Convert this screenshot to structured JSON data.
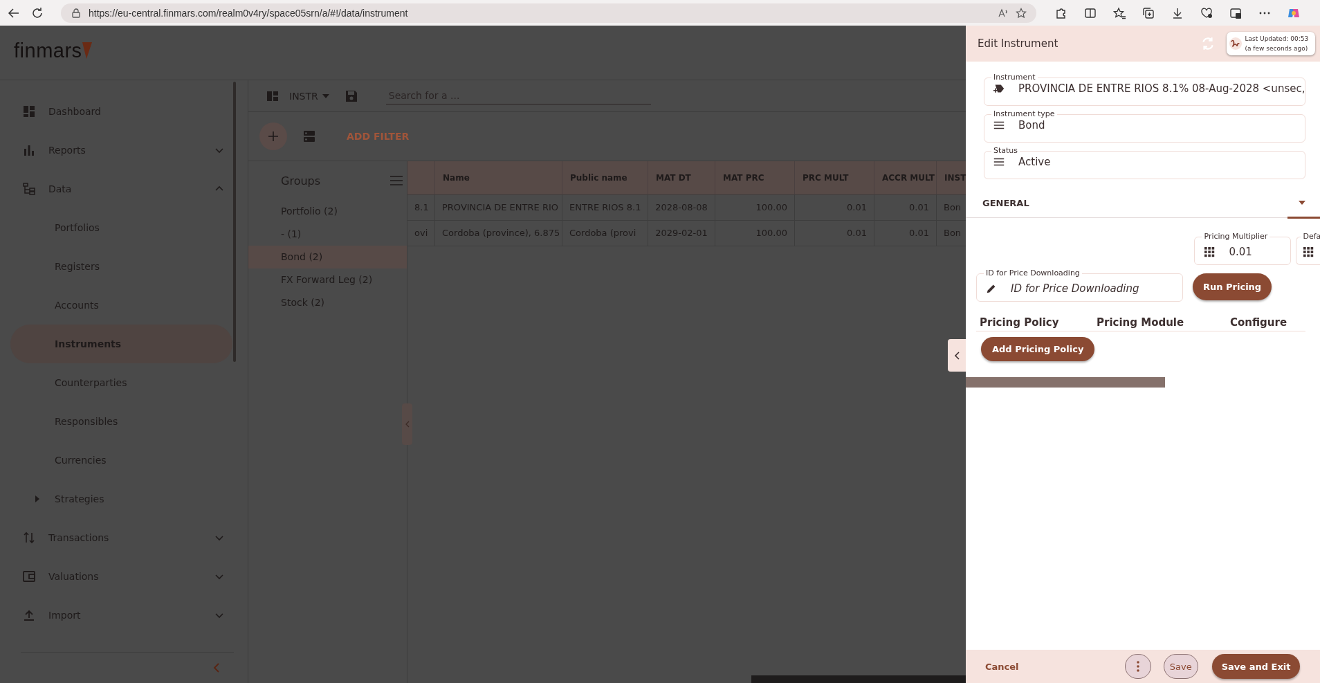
{
  "browser": {
    "url": "https://eu-central.finmars.com/realm0v4ry/space05srn/a/#!/data/instrument"
  },
  "app": {
    "logo": "finmars"
  },
  "sidebar": {
    "items": [
      {
        "label": "Dashboard",
        "selected": false
      },
      {
        "label": "Reports",
        "selected": false,
        "expanded": false
      },
      {
        "label": "Data",
        "selected": false,
        "expanded": true,
        "children": [
          {
            "label": "Portfolios",
            "selected": false
          },
          {
            "label": "Registers",
            "selected": false
          },
          {
            "label": "Accounts",
            "selected": false
          },
          {
            "label": "Instruments",
            "selected": true
          },
          {
            "label": "Counterparties",
            "selected": false
          },
          {
            "label": "Responsibles",
            "selected": false
          },
          {
            "label": "Currencies",
            "selected": false
          },
          {
            "label": "Strategies",
            "selected": false,
            "expanded": false
          }
        ]
      },
      {
        "label": "Transactions",
        "selected": false,
        "expanded": false
      },
      {
        "label": "Valuations",
        "selected": false,
        "expanded": false
      },
      {
        "label": "Import",
        "selected": false,
        "expanded": false
      }
    ]
  },
  "toolbar": {
    "layout": "INSTR",
    "search": {
      "placeholder": "Search for a ..."
    },
    "add_filter": "ADD FILTER"
  },
  "groups": {
    "title": "Groups",
    "items": [
      {
        "label": "Portfolio (2)",
        "selected": false
      },
      {
        "label": "- (1)",
        "selected": false
      },
      {
        "label": "Bond (2)",
        "selected": true
      },
      {
        "label": "FX Forward Leg (2)",
        "selected": false
      },
      {
        "label": "Stock (2)",
        "selected": false
      }
    ]
  },
  "table": {
    "columns": [
      "",
      "Name",
      "Public name",
      "MAT DT",
      "MAT PRC",
      "PRC MULT",
      "ACCR MULT",
      "INST"
    ],
    "rows": [
      {
        "cells": [
          "8.1",
          "PROVINCIA DE ENTRE RIO",
          "ENTRE RIOS  8.1",
          "2028-08-08",
          "100.00",
          "0.01",
          "0.01",
          "Bon"
        ]
      },
      {
        "cells": [
          "ovi",
          "Cordoba (province), 6.875",
          "Cordoba (provi",
          "2029-02-01",
          "100.00",
          "0.01",
          "0.01",
          "Bon"
        ]
      }
    ]
  },
  "panel": {
    "title": "Edit Instrument",
    "last_updated": "Last Updated: 00:53 (a few seconds ago)",
    "fields": [
      {
        "kind": "lookup",
        "label": "Instrument",
        "value": "PROVINCIA DE ENTRE RIOS  8.1%  08-Aug-2028  <unsec,"
      },
      {
        "kind": "select",
        "label": "Instrument type",
        "value": "Bond"
      },
      {
        "kind": "select",
        "label": "Status",
        "value": "Active"
      }
    ],
    "section": {
      "label": "GENERAL",
      "expanded": true
    },
    "number_fields": [
      {
        "label": "Pricing Multiplier",
        "value": "0.01"
      },
      {
        "label": "Defa"
      }
    ],
    "price_id": {
      "label": "ID for Price Downloading",
      "placeholder": "ID for Price Downloading"
    },
    "run_pricing": "Run Pricing",
    "policy_columns": [
      "Pricing Policy",
      "Pricing Module",
      "Configure"
    ],
    "add_policy": "Add Pricing Policy",
    "footer": {
      "cancel": "Cancel",
      "save": "Save",
      "save_exit": "Save and Exit"
    }
  }
}
